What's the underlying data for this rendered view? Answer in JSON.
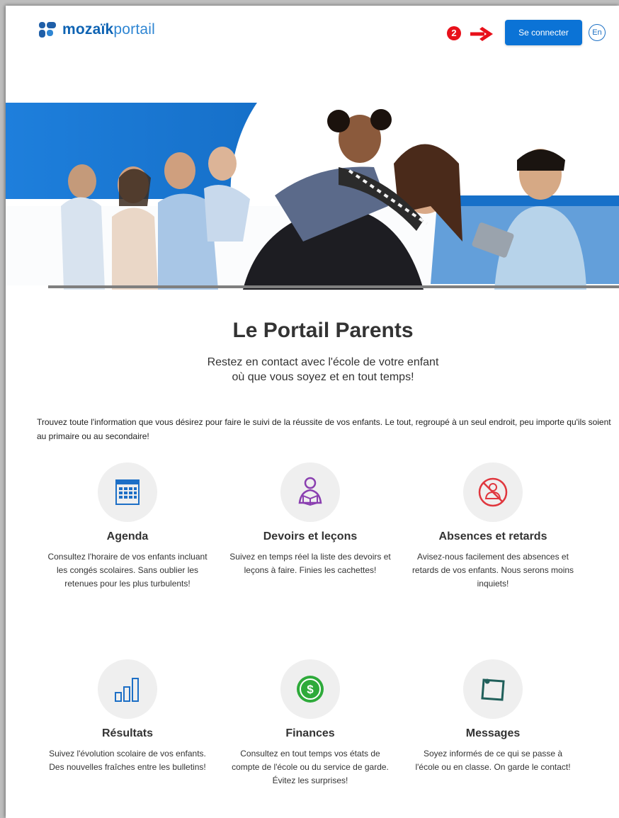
{
  "header": {
    "brand_bold": "mozaïk",
    "brand_light": "portail",
    "step_number": "2",
    "login_button": "Se connecter",
    "lang_button": "En"
  },
  "hero": {
    "title": "Le Portail Parents",
    "subtitle_line1": "Restez en contact avec l'école de votre enfant",
    "subtitle_line2": "où que vous soyez et en tout temps!"
  },
  "intro": "Trouvez toute l'information que vous désirez pour faire le suivi de la réussite de vos enfants. Le tout, regroupé à un seul endroit, peu importe qu'ils soient au primaire ou au secondaire!",
  "features": [
    {
      "icon": "calendar-icon",
      "title": "Agenda",
      "text": "Consultez l'horaire de vos enfants incluant les congés scolaires. Sans oublier les retenues pour les plus turbulents!",
      "color": "#1d6fc6"
    },
    {
      "icon": "student-reading-icon",
      "title": "Devoirs et leçons",
      "text": "Suivez en temps réel la liste des devoirs et leçons à faire. Finies les cachettes!",
      "color": "#8a3fb0"
    },
    {
      "icon": "no-person-icon",
      "title": "Absences et retards",
      "text": "Avisez-nous facilement des absences et retards de vos enfants. Nous serons moins inquiets!",
      "color": "#e0373e"
    },
    {
      "icon": "bar-chart-icon",
      "title": "Résultats",
      "text": "Suivez l'évolution scolaire de vos enfants. Des nouvelles fraîches entre les bulletins!",
      "color": "#1d6fc6"
    },
    {
      "icon": "dollar-coin-icon",
      "title": "Finances",
      "text": "Consultez en tout temps vos états de compte de l'école ou du service de garde. Évitez les surprises!",
      "color": "#2eaa3a"
    },
    {
      "icon": "pinned-note-icon",
      "title": "Messages",
      "text": "Soyez informés de ce qui se passe à l'école ou en classe. On garde le contact!",
      "color": "#1f5f5a"
    }
  ],
  "colors": {
    "brand_blue": "#0b73d6",
    "step_red": "#e8101a"
  }
}
